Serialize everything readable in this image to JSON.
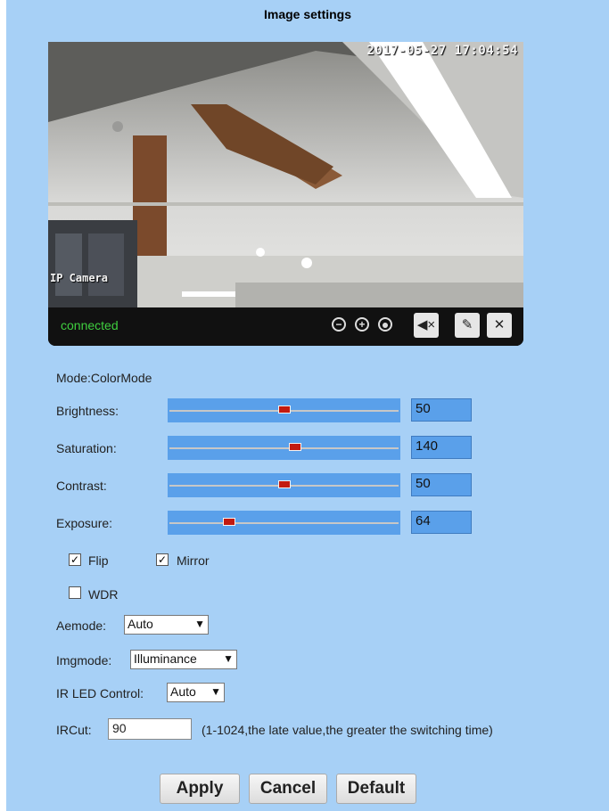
{
  "page": {
    "title": "Image settings"
  },
  "video": {
    "timestamp": "2017-05-27 17:04:54",
    "camera_label": "IP Camera",
    "status": "connected",
    "controls": [
      "zoom-out-icon",
      "zoom-in-icon",
      "record-icon",
      "mute-speaker-icon",
      "mute-mic-icon",
      "settings-tools-icon"
    ]
  },
  "mode": {
    "label": "Mode:ColorMode"
  },
  "sliders": [
    {
      "label": "Brightness:",
      "value": "50",
      "position": 0.5
    },
    {
      "label": "Saturation:",
      "value": "140",
      "position": 0.55
    },
    {
      "label": "Contrast:",
      "value": "50",
      "position": 0.5
    },
    {
      "label": "Exposure:",
      "value": "64",
      "position": 0.25
    }
  ],
  "checks": {
    "flip": {
      "label": "Flip",
      "checked": true
    },
    "mirror": {
      "label": "Mirror",
      "checked": true
    },
    "wdr": {
      "label": "WDR",
      "checked": false
    }
  },
  "aemode": {
    "label": "Aemode:",
    "value": "Auto"
  },
  "imgmode": {
    "label": "Imgmode:",
    "value": "Illuminance"
  },
  "irled": {
    "label": "IR LED Control:",
    "value": "Auto"
  },
  "ircut": {
    "label": "IRCut:",
    "value": "90",
    "hint": "(1-1024,the late value,the greater the switching time)"
  },
  "buttons": {
    "apply": "Apply",
    "cancel": "Cancel",
    "default": "Default"
  },
  "colors": {
    "panel": "#a7d0f6",
    "slider": "#5aa0ea",
    "thumb": "#c31a10",
    "status_green": "#3fcf3f"
  }
}
